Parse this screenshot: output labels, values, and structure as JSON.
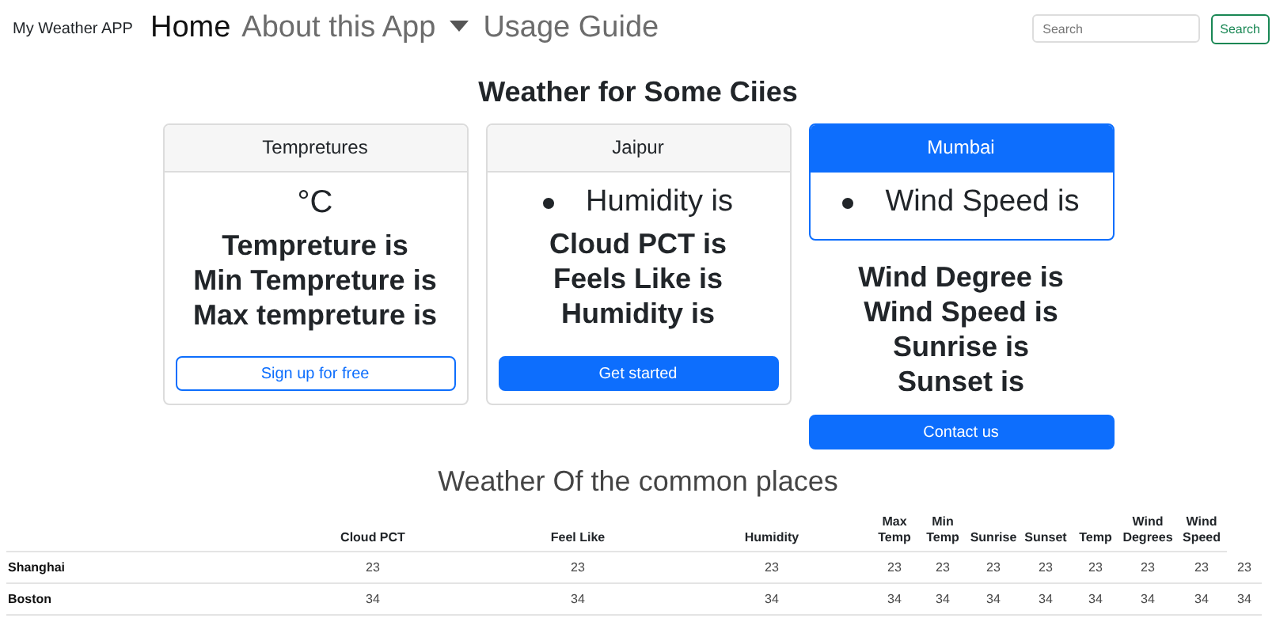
{
  "navbar": {
    "brand": "My Weather APP",
    "links": [
      {
        "label": "Home",
        "selected": true,
        "dropdown": false
      },
      {
        "label": "About this App",
        "selected": false,
        "dropdown": true
      },
      {
        "label": "Usage Guide",
        "selected": false,
        "dropdown": false
      }
    ],
    "search": {
      "placeholder": "Search",
      "button": "Search"
    }
  },
  "heading": "Weather for Some Ciies",
  "cards": [
    {
      "kind": "enclosed",
      "header": "Tempretures",
      "highlighted": false,
      "unit": "°C",
      "lines": [
        "Tempreture is",
        "Min Tempreture is",
        "Max tempreture is"
      ],
      "button": {
        "label": "Sign up for free",
        "kind": "outline"
      }
    },
    {
      "kind": "enclosed",
      "header": "Jaipur",
      "highlighted": false,
      "bullets": [
        "Humidity is"
      ],
      "lines": [
        "Cloud PCT is",
        "Feels Like is",
        "Humidity is"
      ],
      "button": {
        "label": "Get started",
        "kind": "solid"
      }
    },
    {
      "kind": "split",
      "header": "Mumbai",
      "highlighted": true,
      "bullets": [
        "Wind Speed is"
      ],
      "lines": [
        "Wind Degree is",
        "Wind Speed is",
        "Sunrise is",
        "Sunset is"
      ],
      "button": {
        "label": "Contact us",
        "kind": "solid"
      }
    }
  ],
  "subheading": "Weather Of the common places",
  "table": {
    "columns": [
      "Cloud PCT",
      "Feel Like",
      "Humidity",
      "Max Temp",
      "Min Temp",
      "Sunrise",
      "Sunset",
      "Temp",
      "Wind Degrees",
      "Wind Speed"
    ],
    "rows": [
      {
        "name": "Shanghai",
        "values": [
          "23",
          "23",
          "23",
          "23",
          "23",
          "23",
          "23",
          "23",
          "23",
          "23",
          "23"
        ]
      },
      {
        "name": "Boston",
        "values": [
          "34",
          "34",
          "34",
          "34",
          "34",
          "34",
          "34",
          "34",
          "34",
          "34",
          "34"
        ]
      }
    ]
  }
}
